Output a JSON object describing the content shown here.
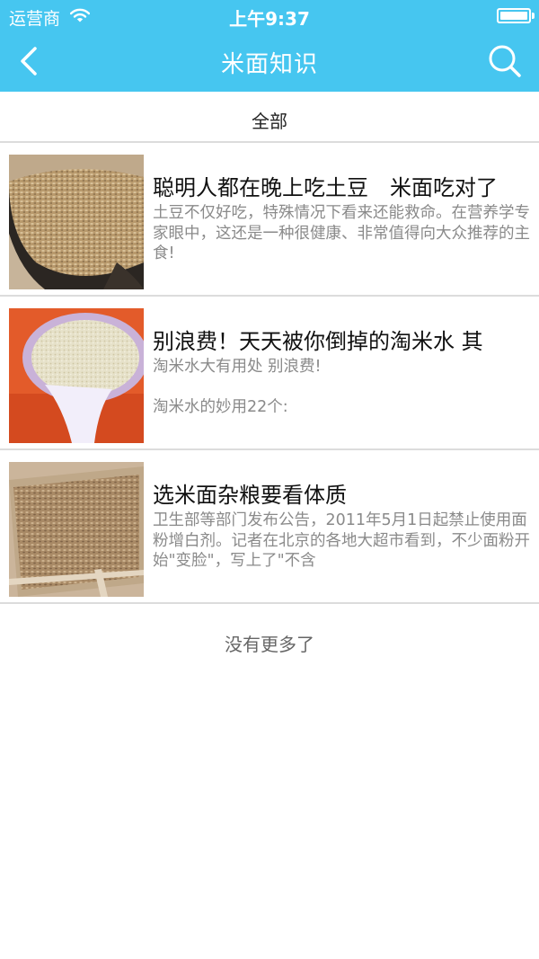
{
  "status_bar": {
    "carrier": "运营商",
    "time": "上午9:37",
    "battery_level": 1.0
  },
  "nav": {
    "title": "米面知识",
    "back_icon": "chevron-left-icon",
    "search_icon": "search-icon"
  },
  "filter": {
    "label": "全部"
  },
  "articles": [
    {
      "title": "聪明人都在晚上吃土豆　米面吃对了",
      "summary": "土豆不仅好吃，特殊情况下看来还能救命。在营养学专家眼中，这还是一种很健康、非常值得向大众推荐的主食!",
      "thumbnail": "rice-in-dark-bowl"
    },
    {
      "title": "别浪费！天天被你倒掉的淘米水 其",
      "summary": "淘米水大有用处 别浪费!\n\n淘米水的妙用22个:",
      "thumbnail": "rice-flour-in-white-scoop"
    },
    {
      "title": "选米面杂粮要看体质",
      "summary": "卫生部等部门发布公告，2011年5月1日起禁止使用面粉增白剂。记者在北京的各地大超市看到，不少面粉开始\"变脸\"，写上了\"不含",
      "thumbnail": "grain-in-wooden-tray"
    }
  ],
  "footer": {
    "no_more": "没有更多了"
  },
  "colors": {
    "header": "#46c6f0",
    "divider": "#dcdcdc",
    "summary_text": "#8a8a8a"
  }
}
